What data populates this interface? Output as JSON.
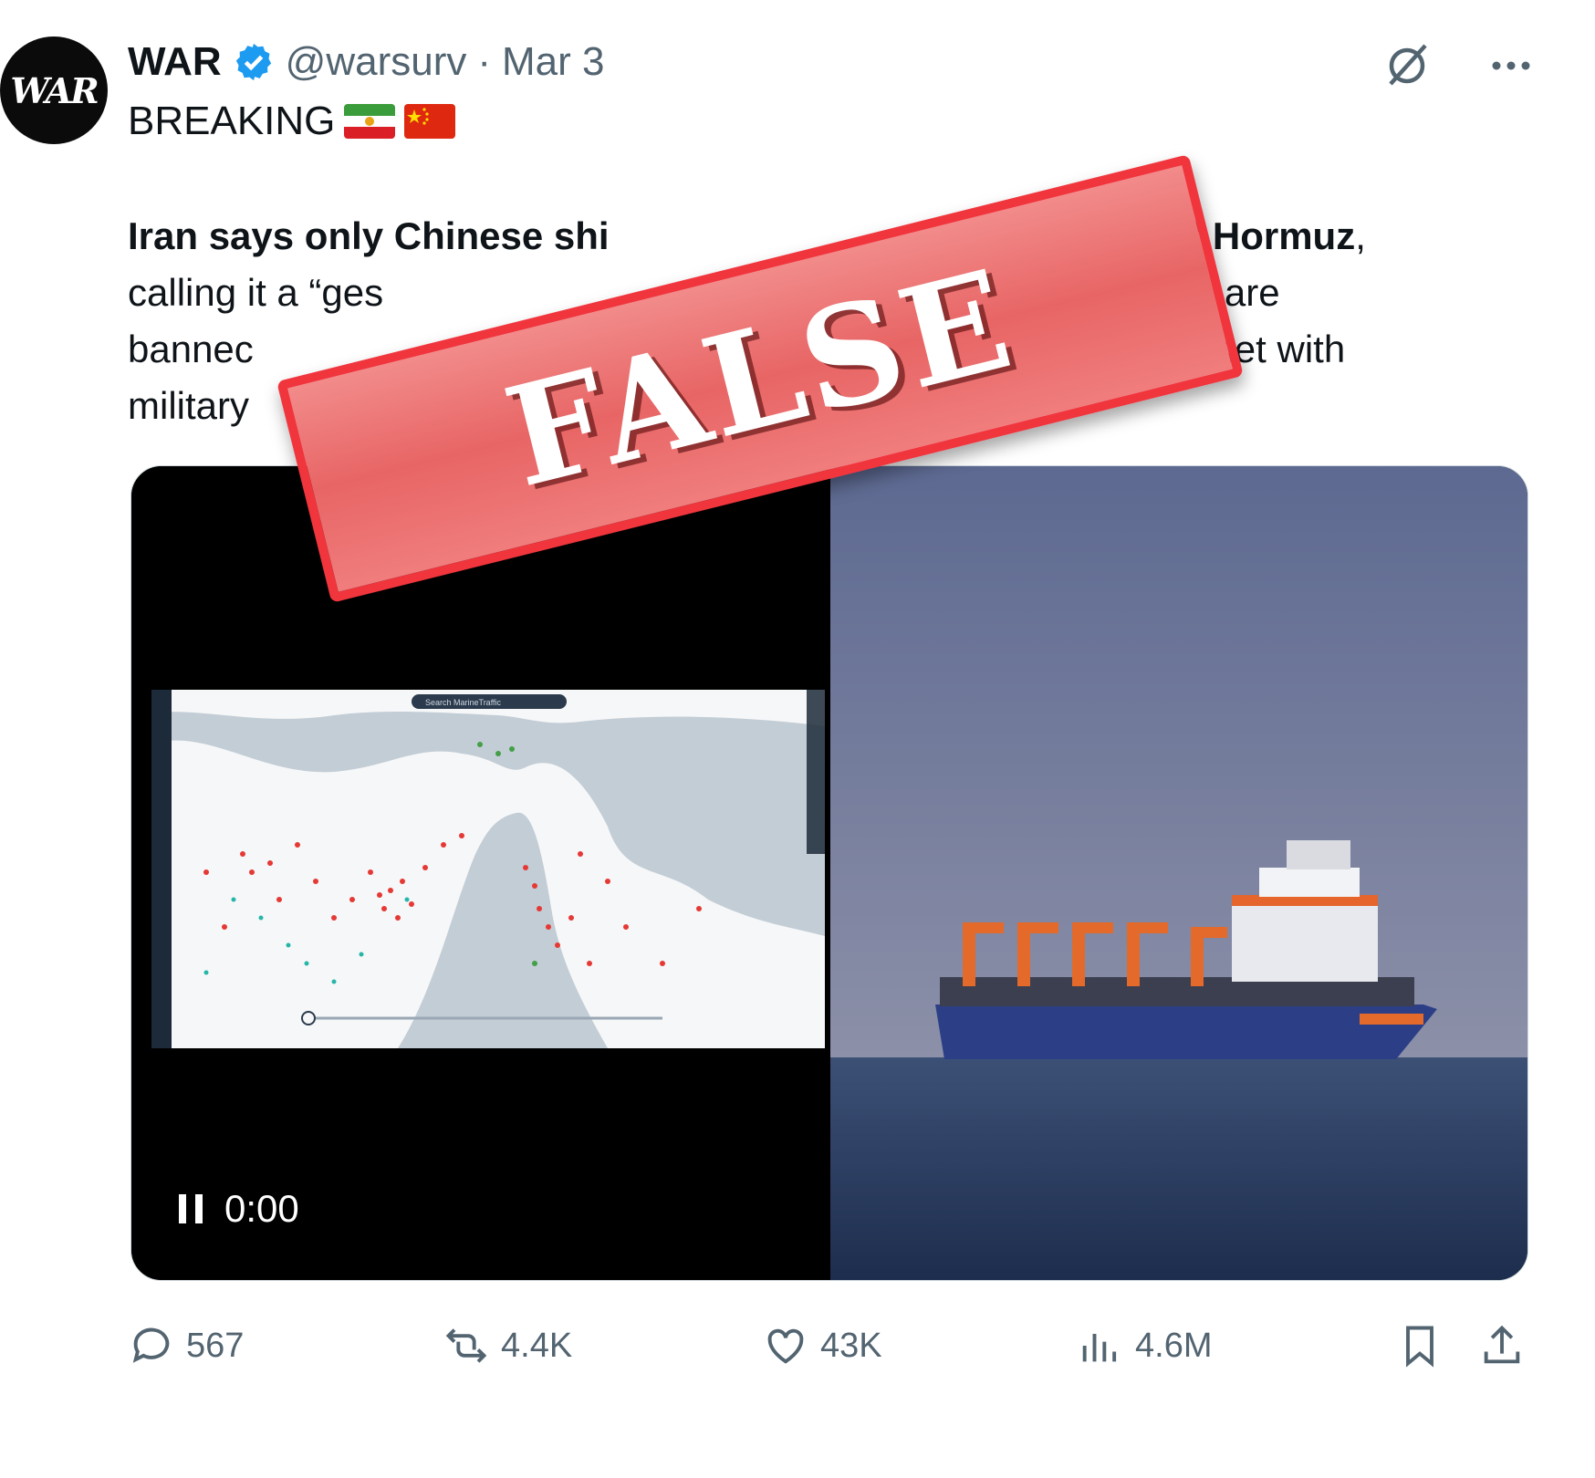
{
  "tweet": {
    "author_name": "WAR",
    "handle": "@warsurv",
    "separator": "·",
    "date": "Mar 3",
    "avatar_text": "WAR",
    "headline": "BREAKING",
    "flags": [
      "iran-lion-sun-flag",
      "china-flag"
    ],
    "body": {
      "bold_part_1": "Iran says only Chinese shi",
      "bold_part_2": "of Hormuz",
      "line1_tail": ",",
      "line2_a": "calling it a “ges",
      "line2_b": "vessels are",
      "line3_a": "bannec",
      "line3_b": "e met with",
      "line4_a": "military"
    }
  },
  "media": {
    "video_time": "0:00",
    "map_search_placeholder": "Search MarineTraffic"
  },
  "actions": {
    "replies": "567",
    "reposts": "4.4K",
    "likes": "43K",
    "views": "4.6M"
  },
  "stamp": {
    "text": "FALSE",
    "color": "#f0353d"
  },
  "colors": {
    "verified": "#1d9bf0",
    "muted": "#536471"
  }
}
